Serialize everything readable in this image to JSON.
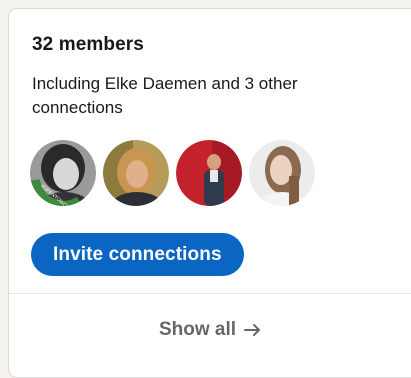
{
  "card": {
    "title": "32 members",
    "subtitle": "Including Elke Daemen and 3 other connections",
    "avatars": [
      {
        "name": "avatar-1",
        "ring_text": "#OPENTOWORK",
        "ring_color": "#3c8a3c"
      },
      {
        "name": "avatar-2"
      },
      {
        "name": "avatar-3"
      },
      {
        "name": "avatar-4"
      }
    ],
    "invite_label": "Invite connections",
    "show_all_label": "Show all",
    "show_all_icon": "arrow-right-icon"
  },
  "colors": {
    "primary": "#0a66c2",
    "open_to_work": "#3c8a3c"
  }
}
